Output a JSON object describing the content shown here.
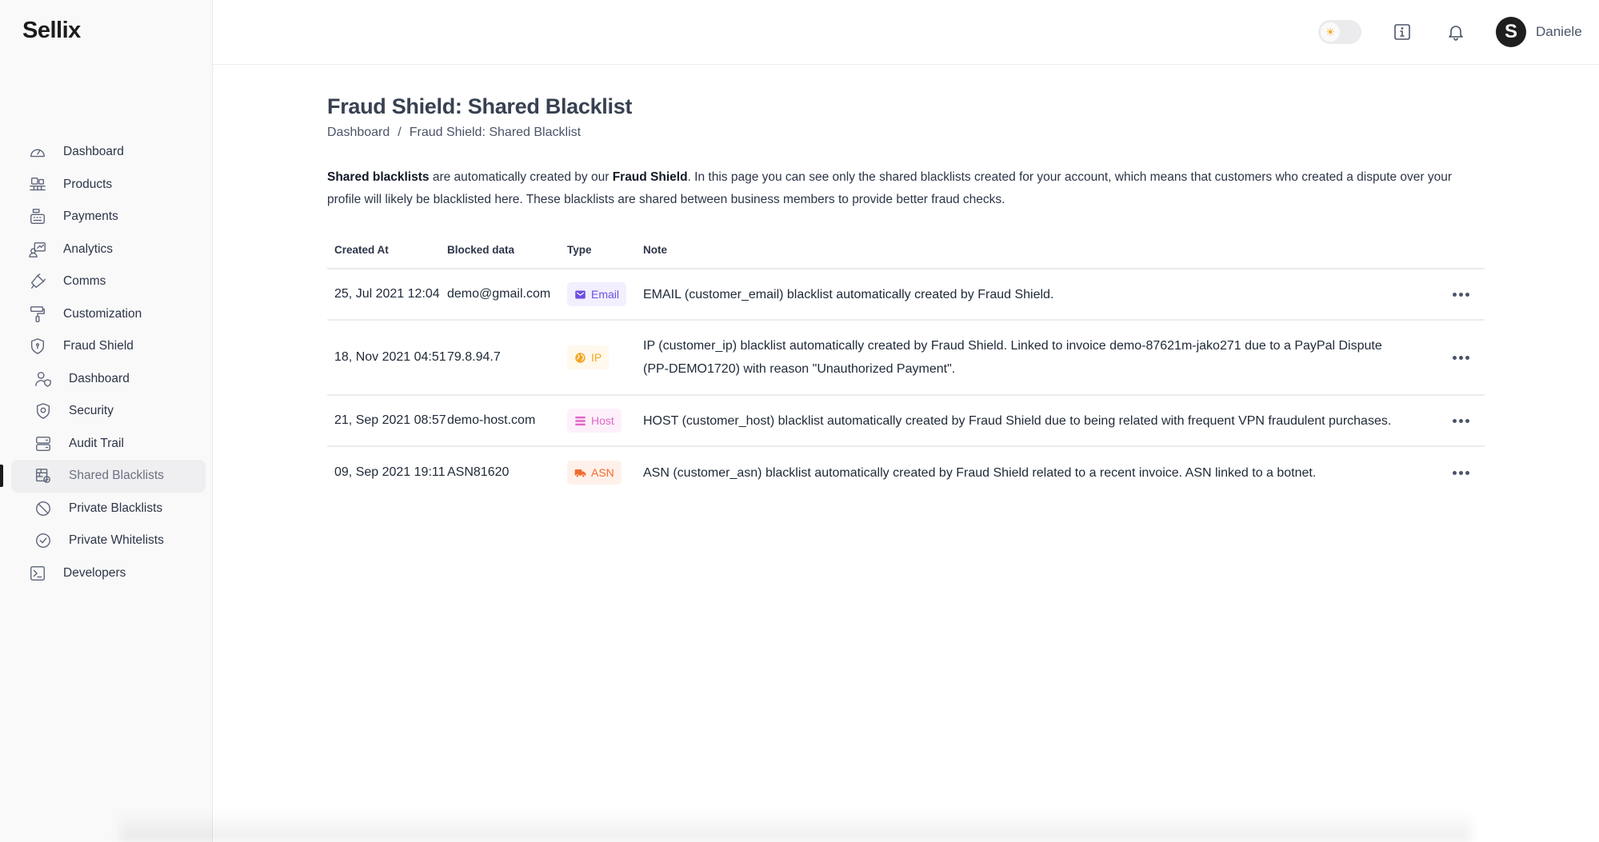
{
  "app": {
    "brand": "Sellix"
  },
  "sidebar": {
    "items": [
      {
        "label": "Dashboard",
        "icon": "gauge-icon",
        "sub": false,
        "active": false
      },
      {
        "label": "Products",
        "icon": "products-icon",
        "sub": false,
        "active": false
      },
      {
        "label": "Payments",
        "icon": "cash-register-icon",
        "sub": false,
        "active": false
      },
      {
        "label": "Analytics",
        "icon": "analytics-icon",
        "sub": false,
        "active": false
      },
      {
        "label": "Comms",
        "icon": "megaphone-icon",
        "sub": false,
        "active": false
      },
      {
        "label": "Customization",
        "icon": "paint-roller-icon",
        "sub": false,
        "active": false
      },
      {
        "label": "Fraud Shield",
        "icon": "shield-icon",
        "sub": false,
        "active": false
      },
      {
        "label": "Dashboard",
        "icon": "user-shield-icon",
        "sub": true,
        "active": false
      },
      {
        "label": "Security",
        "icon": "shield-gear-icon",
        "sub": true,
        "active": false
      },
      {
        "label": "Audit Trail",
        "icon": "server-icon",
        "sub": true,
        "active": false
      },
      {
        "label": "Shared Blacklists",
        "icon": "firewall-icon",
        "sub": true,
        "active": true
      },
      {
        "label": "Private Blacklists",
        "icon": "ban-icon",
        "sub": true,
        "active": false
      },
      {
        "label": "Private Whitelists",
        "icon": "check-circle-icon",
        "sub": true,
        "active": false
      },
      {
        "label": "Developers",
        "icon": "terminal-icon",
        "sub": false,
        "active": false
      }
    ]
  },
  "header": {
    "theme_toggle": {
      "icon": "sun-icon",
      "mode": "light"
    },
    "info_icon": "info-icon",
    "notifications_icon": "bell-icon",
    "user": {
      "avatar_letter": "S",
      "name": "Daniele"
    }
  },
  "page": {
    "title": "Fraud Shield: Shared Blacklist",
    "breadcrumb": {
      "home": "Dashboard",
      "separator": "/",
      "current": "Fraud Shield: Shared Blacklist"
    },
    "description": {
      "bold1": "Shared blacklists",
      "text1": " are automatically created by our ",
      "bold2": "Fraud Shield",
      "text2": ". In this page you can see only the shared blacklists created for your account, which means that customers who created a dispute over your profile will likely be blacklisted here. These blacklists are shared between business members to provide better fraud checks."
    }
  },
  "table": {
    "columns": [
      "Created At",
      "Blocked data",
      "Type",
      "Note"
    ],
    "rows": [
      {
        "created_at": "25, Jul 2021 12:04",
        "blocked_data": "demo@gmail.com",
        "type": {
          "label": "Email",
          "icon": "envelope-icon",
          "color": "#6d4fe0",
          "bg": "#f2efff"
        },
        "note": "EMAIL (customer_email) blacklist automatically created by Fraud Shield."
      },
      {
        "created_at": "18, Nov 2021 04:51",
        "blocked_data": "79.8.94.7",
        "type": {
          "label": "IP",
          "icon": "globe-icon",
          "color": "#f5a623",
          "bg": "#fff8ec"
        },
        "note": "IP (customer_ip) blacklist automatically created by Fraud Shield. Linked to invoice demo-87621m-jako271 due to a PayPal Dispute (PP-DEMO1720) with reason \"Unauthorized Payment\"."
      },
      {
        "created_at": "21, Sep 2021 08:57",
        "blocked_data": "demo-host.com",
        "type": {
          "label": "Host",
          "icon": "list-icon",
          "color": "#e066c8",
          "bg": "#fdf0fb"
        },
        "note": "HOST (customer_host) blacklist automatically created by Fraud Shield due to being related with frequent VPN fraudulent purchases."
      },
      {
        "created_at": "09, Sep 2021 19:11",
        "blocked_data": "ASN81620",
        "type": {
          "label": "ASN",
          "icon": "truck-icon",
          "color": "#f26a2e",
          "bg": "#fff1ea"
        },
        "note": "ASN (customer_asn) blacklist automatically created by Fraud Shield related to a recent invoice. ASN linked to a botnet."
      }
    ],
    "row_action_icon": "more-horizontal-icon"
  }
}
